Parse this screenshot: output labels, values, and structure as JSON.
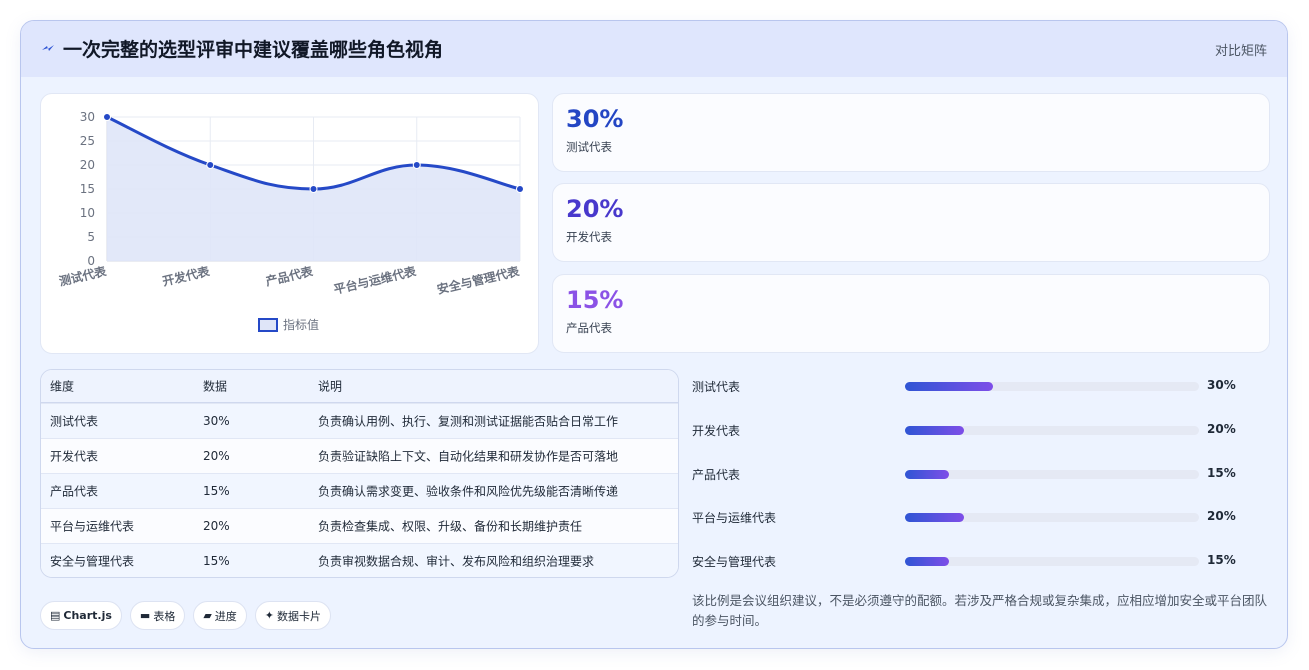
{
  "header": {
    "title": "一次完整的选型评审中建议覆盖哪些角色视角",
    "right_label": "对比矩阵"
  },
  "chart_data": {
    "type": "line",
    "categories": [
      "测试代表",
      "开发代表",
      "产品代表",
      "平台与运维代表",
      "安全与管理代表"
    ],
    "series": [
      {
        "name": "指标值",
        "values": [
          30,
          20,
          15,
          20,
          15
        ]
      }
    ],
    "ylim": [
      0,
      30
    ],
    "yticks": [
      "0",
      "5",
      "10",
      "15",
      "20",
      "25",
      "30"
    ],
    "grid": true,
    "legend": "bottom",
    "colors": {
      "line": "#2549c7",
      "fill": "#dfe5f8"
    }
  },
  "kpis": [
    {
      "value": "30%",
      "label": "测试代表",
      "color": "#2446c4"
    },
    {
      "value": "20%",
      "label": "开发代表",
      "color": "#4838cc"
    },
    {
      "value": "15%",
      "label": "产品代表",
      "color": "#8b52e6"
    }
  ],
  "table": {
    "headers": [
      "维度",
      "数据",
      "说明"
    ],
    "rows": [
      [
        "测试代表",
        "30%",
        "负责确认用例、执行、复测和测试证据能否贴合日常工作"
      ],
      [
        "开发代表",
        "20%",
        "负责验证缺陷上下文、自动化结果和研发协作是否可落地"
      ],
      [
        "产品代表",
        "15%",
        "负责确认需求变更、验收条件和风险优先级能否清晰传递"
      ],
      [
        "平台与运维代表",
        "20%",
        "负责检查集成、权限、升级、备份和长期维护责任"
      ],
      [
        "安全与管理代表",
        "15%",
        "负责审视数据合规、审计、发布风险和组织治理要求"
      ]
    ]
  },
  "progress": [
    {
      "label": "测试代表",
      "value": 30,
      "text": "30%"
    },
    {
      "label": "开发代表",
      "value": 20,
      "text": "20%"
    },
    {
      "label": "产品代表",
      "value": 15,
      "text": "15%"
    },
    {
      "label": "平台与运维代表",
      "value": 20,
      "text": "20%"
    },
    {
      "label": "安全与管理代表",
      "value": 15,
      "text": "15%"
    }
  ],
  "note": "该比例是会议组织建议，不是必须遵守的配额。若涉及严格合规或复杂集成，应相应增加安全或平台团队的参与时间。",
  "chips": [
    {
      "icon": "chart-icon",
      "glyph": "▤",
      "label": "Chart.js"
    },
    {
      "icon": "table-icon",
      "glyph": "▬",
      "label": "表格"
    },
    {
      "icon": "progress-icon",
      "glyph": "▰",
      "label": "进度"
    },
    {
      "icon": "sparkle-icon",
      "glyph": "✦",
      "label": "数据卡片"
    }
  ]
}
